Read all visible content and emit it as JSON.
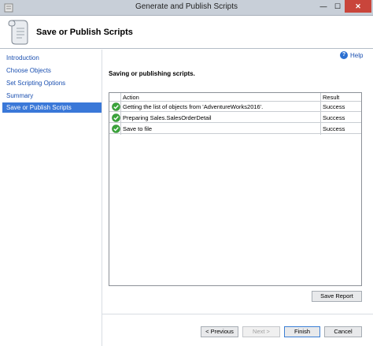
{
  "window": {
    "title": "Generate and Publish Scripts",
    "close_glyph": "✕",
    "min_glyph": "—",
    "max_glyph": "☐"
  },
  "header": {
    "title": "Save or Publish Scripts",
    "icon": "scroll-icon"
  },
  "sidebar": {
    "items": [
      {
        "label": "Introduction",
        "active": false
      },
      {
        "label": "Choose Objects",
        "active": false
      },
      {
        "label": "Set Scripting Options",
        "active": false
      },
      {
        "label": "Summary",
        "active": false
      },
      {
        "label": "Save or Publish Scripts",
        "active": true
      }
    ]
  },
  "help": {
    "label": "Help",
    "glyph": "?"
  },
  "main": {
    "section_title": "Saving or publishing scripts.",
    "table": {
      "columns": [
        "Action",
        "Result"
      ],
      "rows": [
        {
          "action": "Getting the list of objects from 'AdventureWorks2016'.",
          "result": "Success",
          "status_icon": "success-check-icon"
        },
        {
          "action": "Preparing Sales.SalesOrderDetail",
          "result": "Success",
          "status_icon": "success-check-icon"
        },
        {
          "action": "Save to file",
          "result": "Success",
          "status_icon": "success-check-icon"
        }
      ]
    },
    "save_report_label": "Save Report"
  },
  "footer": {
    "previous_label": "< Previous",
    "next_label": "Next >",
    "finish_label": "Finish",
    "cancel_label": "Cancel"
  },
  "colors": {
    "accent": "#3a78d8",
    "link": "#1a4fb0",
    "success": "#3aa53a",
    "close": "#c9453b"
  }
}
